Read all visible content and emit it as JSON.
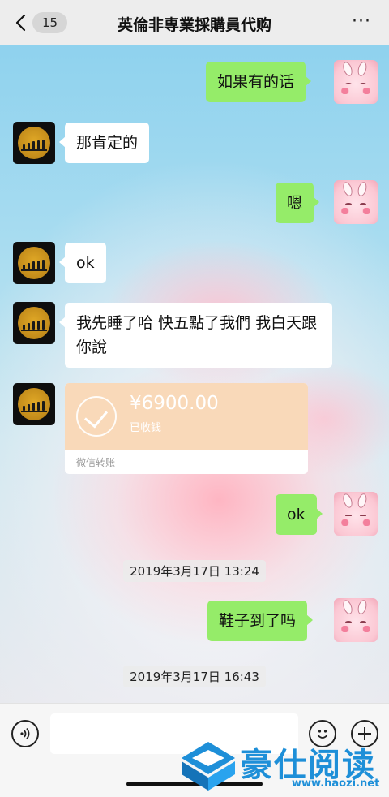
{
  "header": {
    "unread_count": "15",
    "title": "英倫非専業採購員代购",
    "more_label": "···"
  },
  "messages": [
    {
      "side": "out",
      "text": "如果有的话"
    },
    {
      "side": "in",
      "text": "那肯定的"
    },
    {
      "side": "out",
      "text": "嗯"
    },
    {
      "side": "in",
      "text": "ok"
    },
    {
      "side": "in",
      "text": "我先睡了哈 快五點了我們 我白天跟你說"
    },
    {
      "side": "out",
      "text": "ok"
    },
    {
      "side": "out",
      "text": "鞋子到了吗"
    }
  ],
  "transfer": {
    "amount": "¥6900.00",
    "status": "已收钱",
    "footer": "微信转账"
  },
  "timestamps": [
    "2019年3月17日 13:24",
    "2019年3月17日 16:43"
  ],
  "input": {
    "placeholder": ""
  },
  "icons": {
    "back": "chevron-left-icon",
    "more": "more-dots-icon",
    "voice": "voice-icon",
    "emoji": "emoji-icon",
    "add": "plus-icon"
  },
  "watermark": {
    "text": "豪仕阅读",
    "url": "www.haozi.net"
  },
  "colors": {
    "outgoing_bubble": "#95ec69",
    "incoming_bubble": "#ffffff",
    "transfer_card": "#f9d9b9",
    "watermark": "#1e8fd8"
  }
}
